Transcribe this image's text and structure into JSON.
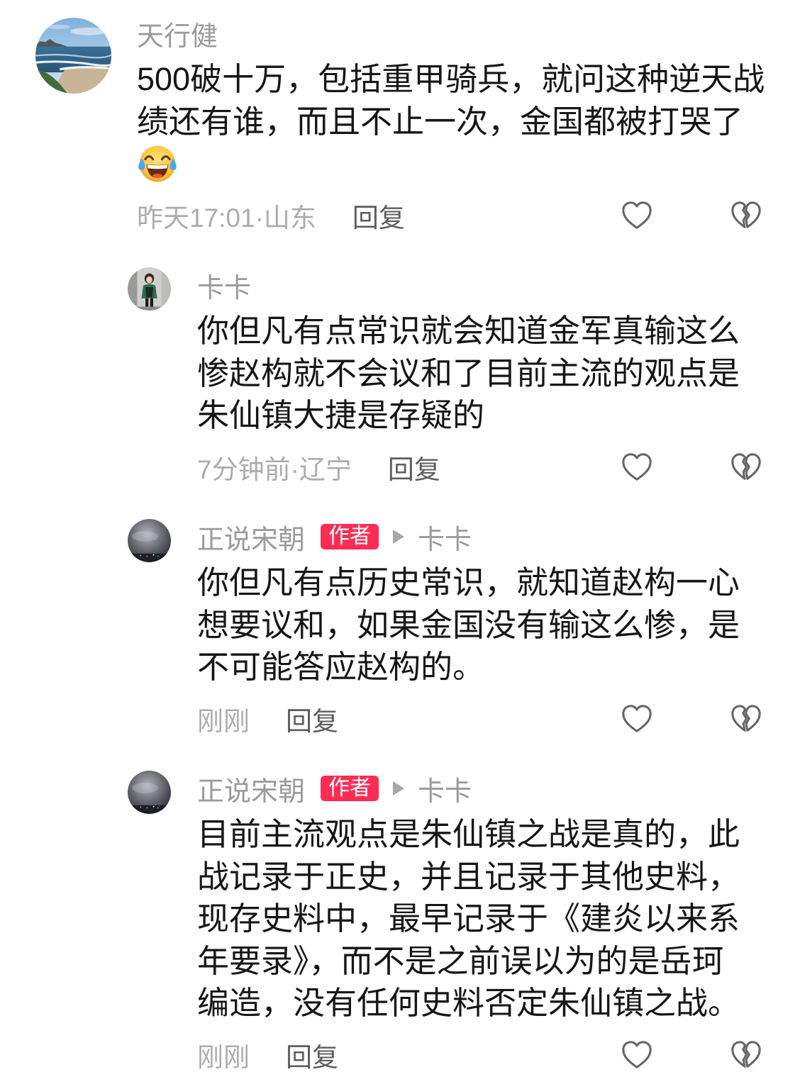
{
  "comment": {
    "username": "天行健",
    "text_lines": [
      "500破十万，包括重甲骑兵，就问这种逆天战",
      "绩还有谁，而且不止一次，金国都被打哭了"
    ],
    "emoji_icon": "face-with-tears-of-joy",
    "time_location": "昨天17:01·山东",
    "reply_label": "回复",
    "replies": [
      {
        "username": "卡卡",
        "text_lines": [
          "你但凡有点常识就会知道金军真输这么",
          "惨赵构就不会议和了目前主流的观点是",
          "朱仙镇大捷是存疑的"
        ],
        "time_location": "7分钟前·辽宁",
        "reply_label": "回复"
      },
      {
        "username": "正说宋朝",
        "author_badge": "作者",
        "reply_to": "卡卡",
        "text_lines": [
          "你但凡有点历史常识，就知道赵构一心",
          "想要议和，如果金国没有输这么惨，是",
          "不可能答应赵构的。"
        ],
        "time_location": "刚刚",
        "reply_label": "回复"
      },
      {
        "username": "正说宋朝",
        "author_badge": "作者",
        "reply_to": "卡卡",
        "text_lines": [
          "目前主流观点是朱仙镇之战是真的，此",
          "战记录于正史，并且记录于其他史料，",
          "现存史料中，最早记录于《建炎以来系",
          "年要录》，而不是之前误以为的是岳珂",
          "编造，没有任何史料否定朱仙镇之战。"
        ],
        "time_location": "刚刚",
        "reply_label": "回复"
      }
    ]
  },
  "icons": {
    "like": "heart-icon",
    "dislike": "broken-heart-icon",
    "reply_to_arrow": "play-triangle-icon"
  },
  "colors": {
    "text": "#161616",
    "username": "#9b9b9b",
    "meta": "#acacac",
    "reply": "#5d5d5d",
    "author_badge": "#fe2c55",
    "icon": "#666666"
  }
}
